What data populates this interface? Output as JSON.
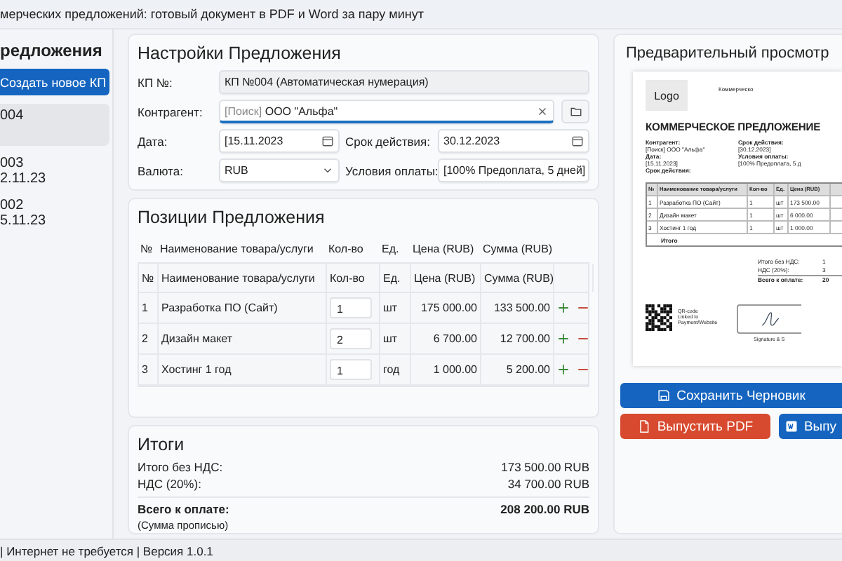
{
  "window": {
    "title": "мерческих предложений: готовый документ в PDF и Word за пару минут"
  },
  "sidebar": {
    "title": "редложения",
    "new_button": "Создать новое КП",
    "items": [
      {
        "lines": [
          "004"
        ],
        "selected": true
      },
      {
        "lines": [
          "003",
          "2.11.23"
        ],
        "selected": false
      },
      {
        "lines": [
          "002",
          "5.11.23"
        ],
        "selected": false
      }
    ]
  },
  "settings": {
    "title": "Настройки Предложения",
    "number": {
      "label": "КП №:",
      "value": "КП №004 (Автоматическая нумерация)"
    },
    "counterparty": {
      "label": "Контрагент:",
      "prefix": "[Поиск]",
      "value": "ООО \"Альфа\""
    },
    "date": {
      "label": "Дата:",
      "value": "[15.11.2023"
    },
    "valid_until": {
      "label": "Срок действия:",
      "value": "30.12.2023"
    },
    "currency": {
      "label": "Валюта:",
      "value": "RUB"
    },
    "payment_terms": {
      "label": "Условия оплаты:",
      "value": "[100% Предоплата, 5 дней]"
    }
  },
  "positions": {
    "title": "Позиции Предложения",
    "columns": [
      "№",
      "Наименование товара/услуги",
      "Кол-во",
      "Ед.",
      "Цена (RUB)",
      "Сумма (RUB)"
    ],
    "table_columns": [
      "№",
      "Наименование товара/услуги",
      "Кол-во",
      "Ед.",
      "Цена (RUB)",
      "Сумма (RUB)"
    ],
    "rows": [
      {
        "num": "1",
        "name": "Разработка ПО (Сайт)",
        "qty": "1",
        "unit": "шт",
        "price": "175 000.00",
        "sum": "133 500.00"
      },
      {
        "num": "2",
        "name": "Дизайн макет",
        "qty": "2",
        "unit": "шт",
        "price": "6 700.00",
        "sum": "12 700.00"
      },
      {
        "num": "3",
        "name": "Хостинг 1 год",
        "qty": "1",
        "unit": "год",
        "price": "1 000.00",
        "sum": "5 200.00"
      }
    ]
  },
  "totals": {
    "title": "Итоги",
    "lines": [
      {
        "label": "Итого без НДС:",
        "value": "173 500.00 RUB"
      },
      {
        "label": "НДС (20%):",
        "value": "34 700.00 RUB"
      }
    ],
    "total": {
      "label": "Всего к оплате:",
      "value": "208 200.00 RUB"
    },
    "in_words": "(Сумма прописью)"
  },
  "preview": {
    "title": "Предварительный просмотр",
    "logo": "Logo",
    "header_text": "Коммерческо",
    "doc_title": "КОММЕРЧЕСКОЕ ПРЕДЛОЖЕНИЕ",
    "left_fields": [
      {
        "label": "Контрагент:",
        "value": "[Поиск] ООО \"Альфа\""
      },
      {
        "label": "Дата:",
        "value": "[15.11.2023]"
      },
      {
        "label": "Срок действия:"
      }
    ],
    "right_fields": [
      {
        "label": "Срок действия:",
        "value": "[30.12.2023]"
      },
      {
        "label": "Условия оплаты:",
        "value": "[100% Предоплата, 5 д"
      }
    ],
    "columns": [
      "№",
      "Наименование товара/услуги",
      "Кол-во",
      "Ед.",
      "Цена (RUB)"
    ],
    "rows": [
      {
        "num": "1",
        "name": "Разработка ПО (Сайт)",
        "qty": "1",
        "unit": "шт",
        "price": "173 500.00"
      },
      {
        "num": "2",
        "name": "Дизайн макет",
        "qty": "1",
        "unit": "шт",
        "price": "6 000.00"
      },
      {
        "num": "3",
        "name": "Хостинг 1 год",
        "qty": "1",
        "unit": "шт",
        "price": "1 000.00"
      }
    ],
    "total_row": "Итого",
    "totals": [
      {
        "label": "Итого без НДС:",
        "value": "1"
      },
      {
        "label": "НДС (20%):",
        "value": "3"
      },
      {
        "label": "Всего к оплате:",
        "value": "20"
      }
    ],
    "qr_text": [
      "QR-code",
      "Linked to",
      "Payment/Website"
    ],
    "signature_label": "Signature & S"
  },
  "buttons": {
    "save": "Сохранить Черновик",
    "pdf": "Выпустить PDF",
    "word": "Выпу"
  },
  "status_bar": "| Интернет не требуется | Версия 1.0.1"
}
